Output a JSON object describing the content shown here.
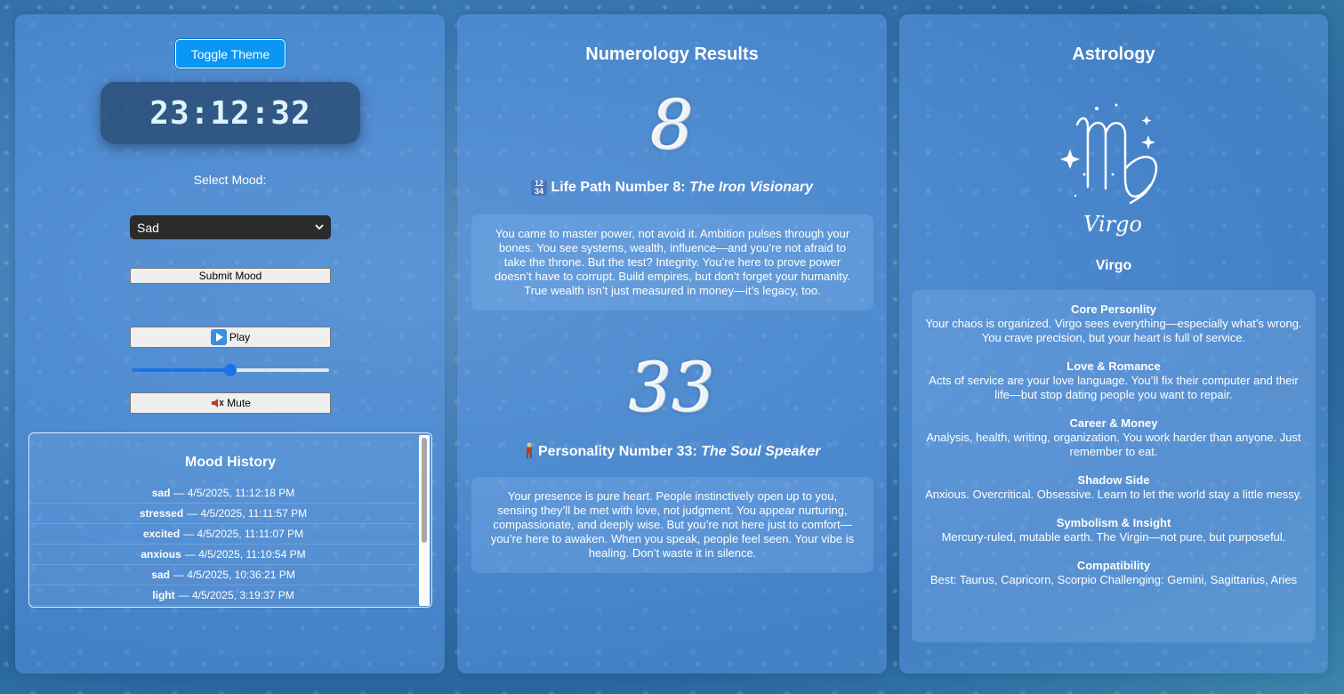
{
  "left": {
    "toggle_label": "Toggle Theme",
    "clock": "23:12:32",
    "mood_label": "Select Mood:",
    "mood_selected": "Sad",
    "submit_label": "Submit Mood",
    "play_label": "Play",
    "mute_label": "Mute",
    "volume": 0.5,
    "history_title": "Mood History",
    "history": [
      {
        "mood": "sad",
        "time": "— 4/5/2025, 11:12:18 PM"
      },
      {
        "mood": "stressed",
        "time": "— 4/5/2025, 11:11:57 PM"
      },
      {
        "mood": "excited",
        "time": "— 4/5/2025, 11:11:07 PM"
      },
      {
        "mood": "anxious",
        "time": "— 4/5/2025, 11:10:54 PM"
      },
      {
        "mood": "sad",
        "time": "— 4/5/2025, 10:36:21 PM"
      },
      {
        "mood": "light",
        "time": "— 4/5/2025, 3:19:37 PM"
      }
    ]
  },
  "numerology": {
    "title": "Numerology Results",
    "life_path_number": "8",
    "life_path_heading": "Life Path Number 8: ",
    "life_path_name": "The Iron Visionary",
    "life_path_text": "You came to master power, not avoid it. Ambition pulses through your bones. You see systems, wealth, influence—and you’re not afraid to take the throne. But the test? Integrity. You’re here to prove power doesn’t have to corrupt. Build empires, but don’t forget your humanity. True wealth isn’t just measured in money—it’s legacy, too.",
    "personality_number": "33",
    "personality_heading": "Personality Number 33: ",
    "personality_name": "The Soul Speaker",
    "personality_text": "Your presence is pure heart. People instinctively open up to you, sensing they’ll be met with love, not judgment. You appear nurturing, compassionate, and deeply wise. But you’re not here just to comfort—you’re here to awaken. When you speak, people feel seen. Your vibe is healing. Don’t waste it in silence."
  },
  "astrology": {
    "title": "Astrology",
    "sign_logo_text": "Virgo",
    "sign_name": "Virgo",
    "sections": [
      {
        "heading": "Core Personlity",
        "text": "Your chaos is organized. Virgo sees everything—especially what’s wrong. You crave precision, but your heart is full of service."
      },
      {
        "heading": "Love & Romance",
        "text": "Acts of service are your love language. You’ll fix their computer and their life—but stop dating people you want to repair."
      },
      {
        "heading": "Career & Money",
        "text": "Analysis, health, writing, organization. You work harder than anyone. Just remember to eat."
      },
      {
        "heading": "Shadow Side",
        "text": "Anxious. Overcritical. Obsessive. Learn to let the world stay a little messy."
      },
      {
        "heading": "Symbolism & Insight",
        "text": "Mercury-ruled, mutable earth. The Virgin—not pure, but purposeful."
      },
      {
        "heading": "Compatibility",
        "text": "Best: Taurus, Capricorn, Scorpio Challenging: Gemini, Sagittarius, Aries"
      }
    ]
  }
}
